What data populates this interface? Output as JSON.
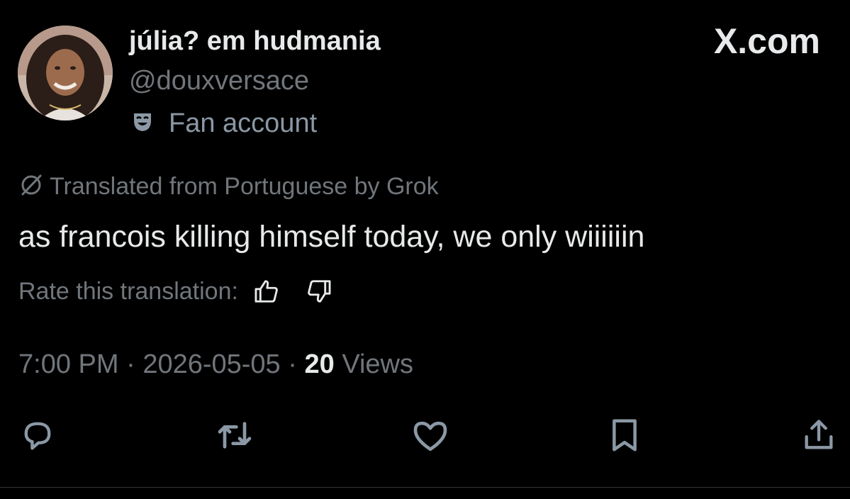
{
  "author": {
    "display_name": "júlia? em hudmania",
    "handle": "@douxversace",
    "badge_label": "Fan account",
    "badge_icon": "theater-mask-icon"
  },
  "brand": {
    "label": "X.com"
  },
  "translation": {
    "notice": "Translated from Portuguese by Grok",
    "rate_label": "Rate this translation:"
  },
  "tweet": {
    "text": "as francois killing himself today, we only wiiiiiin"
  },
  "meta": {
    "time": "7:00 PM",
    "separator": " · ",
    "date": "2026-05-05",
    "views_count": "20",
    "views_label": " Views"
  },
  "actions": [
    "reply-icon",
    "repost-icon",
    "like-icon",
    "bookmark-icon",
    "share-icon"
  ],
  "colors": {
    "background": "#000000",
    "primary_text": "#e7e9ea",
    "secondary_text": "#71767b",
    "badge_text": "#8b98a5"
  }
}
